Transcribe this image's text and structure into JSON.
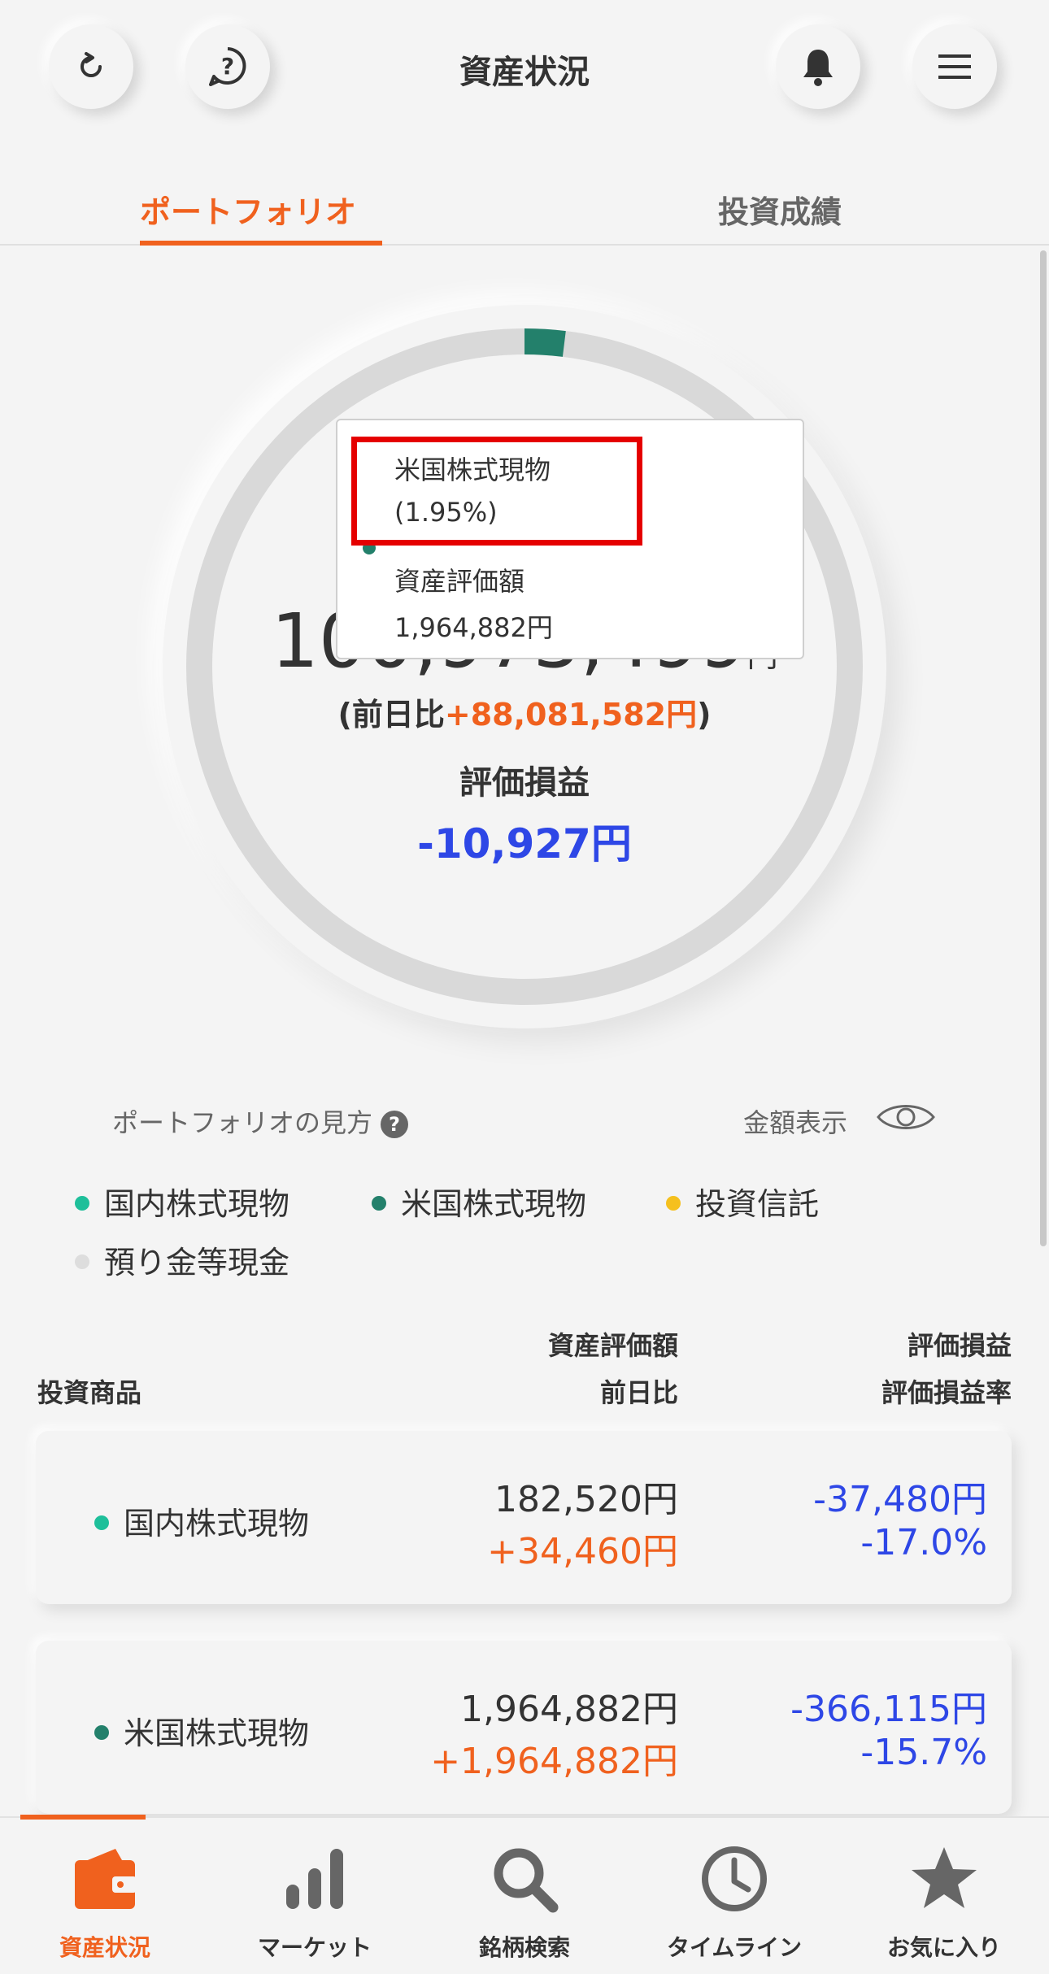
{
  "header": {
    "title": "資産状況",
    "refresh_icon": "refresh-icon",
    "help_icon": "help-icon",
    "bell_icon": "bell-icon",
    "menu_icon": "menu-icon"
  },
  "tabs": [
    {
      "label": "ポートフォリオ",
      "active": true
    },
    {
      "label": "投資成績",
      "active": false
    }
  ],
  "summary": {
    "total_label": "資産評価額",
    "total_value": "100,973,499",
    "unit": "円",
    "diff_prefix": "(前日比",
    "diff_value": "+88,081,582円",
    "diff_suffix": ")",
    "pl_label": "評価損益",
    "pl_value": "-10,927円"
  },
  "tooltip": {
    "name": "米国株式現物",
    "percent": "(1.95%)",
    "value_label": "資産評価額",
    "value": "1,964,882円"
  },
  "portfolio_help": "ポートフォリオの見方",
  "amount_toggle": "金額表示",
  "legend": [
    {
      "label": "国内株式現物",
      "color": "#1ebf9a"
    },
    {
      "label": "米国株式現物",
      "color": "#23806b"
    },
    {
      "label": "投資信託",
      "color": "#f5c01e"
    },
    {
      "label": "預り金等現金",
      "color": "#dddddd"
    }
  ],
  "table_header": {
    "product": "投資商品",
    "value_line1": "資産評価額",
    "value_line2": "前日比",
    "pl_line1": "評価損益",
    "pl_line2": "評価損益率"
  },
  "rows": [
    {
      "name": "国内株式現物",
      "color": "#1ebf9a",
      "value": "182,520円",
      "diff": "+34,460円",
      "pl": "-37,480円",
      "pl_rate": "-17.0%"
    },
    {
      "name": "米国株式現物",
      "color": "#23806b",
      "value": "1,964,882円",
      "diff": "+1,964,882円",
      "pl": "-366,115円",
      "pl_rate": "-15.7%"
    }
  ],
  "chart_data": {
    "type": "pie",
    "categories": [
      "米国株式現物"
    ],
    "values": [
      1.95
    ]
  },
  "nav": [
    {
      "label": "資産状況",
      "icon": "wallet-icon",
      "active": true
    },
    {
      "label": "マーケット",
      "icon": "bar-chart-icon",
      "active": false
    },
    {
      "label": "銘柄検索",
      "icon": "search-icon",
      "active": false
    },
    {
      "label": "タイムライン",
      "icon": "clock-icon",
      "active": false
    },
    {
      "label": "お気に入り",
      "icon": "star-icon",
      "active": false
    }
  ],
  "colors": {
    "accent": "#f0611e",
    "negative": "#2e47e6",
    "highlight_box": "#e50000"
  }
}
